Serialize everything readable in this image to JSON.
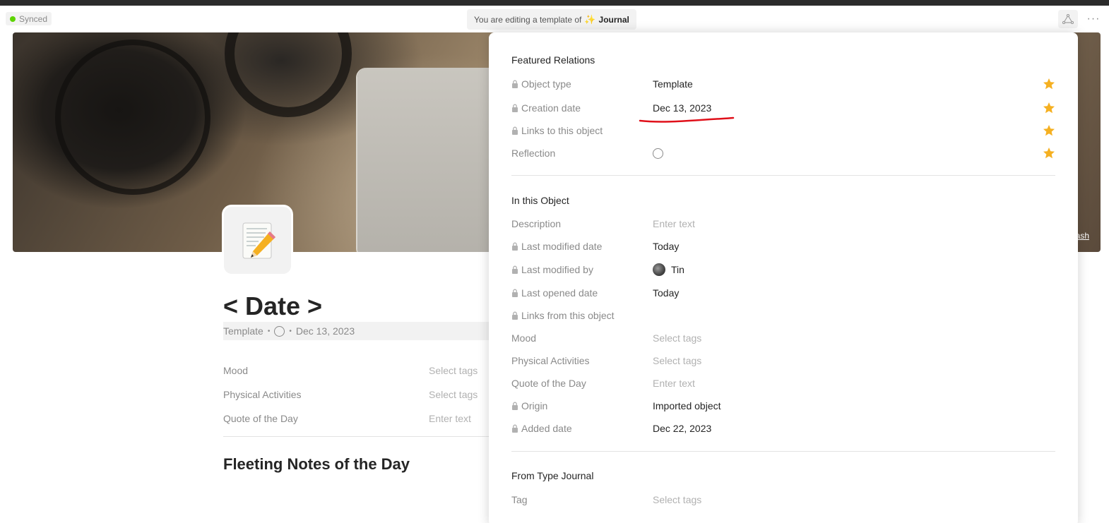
{
  "header": {
    "sync_status": "Synced",
    "template_prefix": "You are editing a template of",
    "template_type_emoji": "✨",
    "template_type_name": "Journal",
    "more_label": "···",
    "status_color": "#5dd400"
  },
  "cover": {
    "credit_fragment": "ash"
  },
  "page": {
    "icon_emoji": "📝",
    "title": "< Date >",
    "meta": {
      "type": "Template",
      "date": "Dec 13, 2023"
    },
    "relations": [
      {
        "label": "Mood",
        "value": "Select tags"
      },
      {
        "label": "Physical Activities",
        "value": "Select tags"
      },
      {
        "label": "Quote of the Day",
        "value": "Enter text"
      }
    ],
    "heading": "Fleeting Notes of the Day"
  },
  "panel": {
    "featured": {
      "title": "Featured Relations",
      "rows": [
        {
          "label": "Object type",
          "value": "Template"
        },
        {
          "label": "Creation date",
          "value": "Dec 13, 2023"
        },
        {
          "label": "Links to this object",
          "value": ""
        },
        {
          "label": "Reflection",
          "value": ""
        }
      ]
    },
    "in_object": {
      "title": "In this Object",
      "rows": [
        {
          "label": "Description",
          "value": "Enter text"
        },
        {
          "label": "Last modified date",
          "value": "Today"
        },
        {
          "label": "Last modified by",
          "value": "Tin"
        },
        {
          "label": "Last opened date",
          "value": "Today"
        },
        {
          "label": "Links from this object",
          "value": ""
        },
        {
          "label": "Mood",
          "value": "Select tags"
        },
        {
          "label": "Physical Activities",
          "value": "Select tags"
        },
        {
          "label": "Quote of the Day",
          "value": "Enter text"
        },
        {
          "label": "Origin",
          "value": "Imported object"
        },
        {
          "label": "Added date",
          "value": "Dec 22, 2023"
        }
      ]
    },
    "from_type": {
      "title": "From Type Journal",
      "rows": [
        {
          "label": "Tag",
          "value": "Select tags"
        }
      ]
    },
    "star_color": "#f5b021",
    "annotation_color": "#e0101a"
  }
}
